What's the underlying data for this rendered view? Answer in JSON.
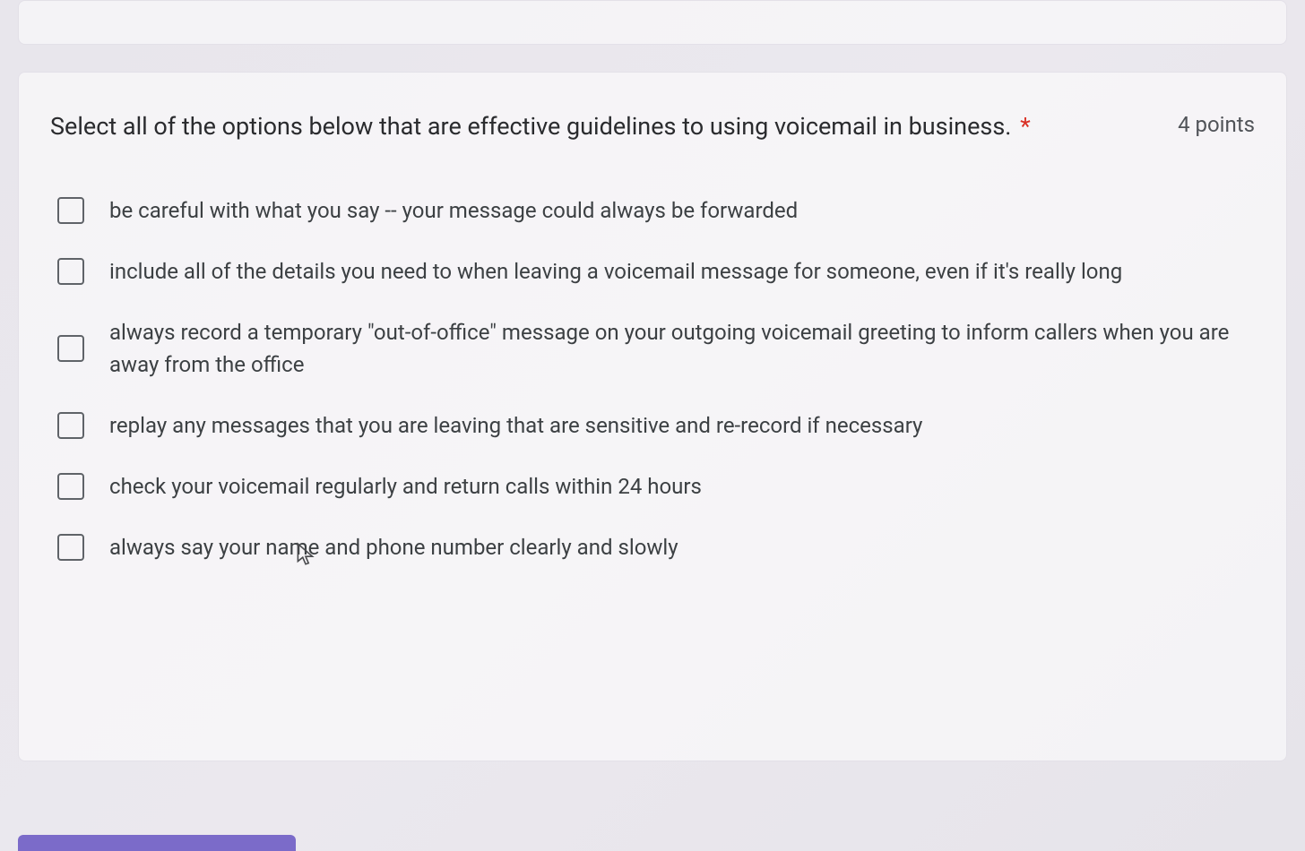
{
  "question": {
    "text": "Select all of the options below that are effective guidelines to using voicemail in business.",
    "required_marker": "*",
    "points": "4 points"
  },
  "options": [
    {
      "label": "be careful with what you say -- your message could always be forwarded",
      "checked": false
    },
    {
      "label": "include all of the details you need to when leaving a voicemail message for someone, even if it's really long",
      "checked": false
    },
    {
      "label": "always record a temporary \"out-of-office\" message on your outgoing voicemail greeting to inform callers when you are away from the office",
      "checked": false
    },
    {
      "label": "replay any messages that you are leaving that are sensitive and re-record if necessary",
      "checked": false
    },
    {
      "label": "check your voicemail regularly and return calls within 24 hours",
      "checked": false
    },
    {
      "label": "always say your name and phone number clearly and slowly",
      "checked": false
    }
  ]
}
